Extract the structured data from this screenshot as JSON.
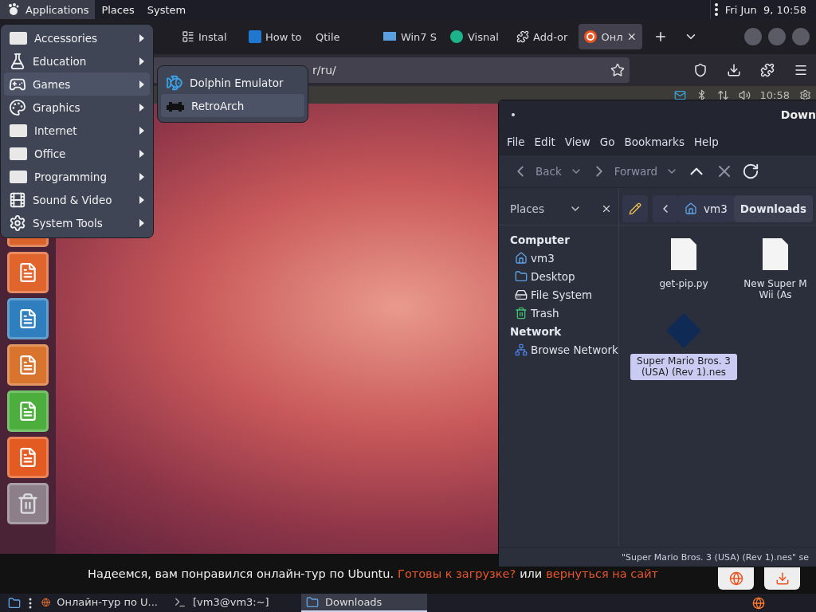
{
  "top_panel": {
    "menus": [
      {
        "label": "Applications",
        "selected": true
      },
      {
        "label": "Places",
        "selected": false
      },
      {
        "label": "System",
        "selected": false
      }
    ],
    "clock": "Fri Jun  9, 10:58"
  },
  "browser": {
    "tabs": [
      {
        "label": "Instal",
        "kind": "list",
        "selected": false
      },
      {
        "label": "How to",
        "kind": "letter",
        "selected": false
      },
      {
        "label": "Qtile",
        "kind": "none",
        "selected": false
      },
      {
        "label": "Win7 S",
        "kind": "windows",
        "selected": false
      },
      {
        "label": "Visnal",
        "kind": "badge",
        "selected": false
      },
      {
        "label": "Add-or",
        "kind": "puzzle",
        "selected": false
      },
      {
        "label": "Онл",
        "kind": "ubuntu",
        "selected": true
      }
    ],
    "url": "r/ru/",
    "tour": {
      "clock": "10:58",
      "caption": "Надеемся, вам понравился онлайн-тур по Ubuntu.",
      "link_download": "Готовы к загрузке?",
      "joiner": "или",
      "link_back": "вернуться на сайт"
    }
  },
  "app_menu": {
    "items": [
      {
        "label": "Accessories",
        "kind": "blank",
        "selected": false
      },
      {
        "label": "Education",
        "kind": "flask",
        "selected": false
      },
      {
        "label": "Games",
        "kind": "gamepad",
        "selected": true
      },
      {
        "label": "Graphics",
        "kind": "palette",
        "selected": false
      },
      {
        "label": "Internet",
        "kind": "blank",
        "selected": false
      },
      {
        "label": "Office",
        "kind": "blank",
        "selected": false
      },
      {
        "label": "Programming",
        "kind": "blank",
        "selected": false
      },
      {
        "label": "Sound & Video",
        "kind": "film",
        "selected": false
      },
      {
        "label": "System Tools",
        "kind": "gear",
        "selected": false
      }
    ]
  },
  "games_submenu": {
    "items": [
      {
        "label": "Dolphin Emulator",
        "kind": "dolphin",
        "selected": false
      },
      {
        "label": "RetroArch",
        "kind": "invader",
        "selected": true
      }
    ]
  },
  "file_manager": {
    "title": "Down",
    "menu": [
      "File",
      "Edit",
      "View",
      "Go",
      "Bookmarks",
      "Help"
    ],
    "toolbar": {
      "back": "Back",
      "forward": "Forward"
    },
    "sidebar": {
      "header": "Places",
      "sections": [
        {
          "heading": "Computer",
          "items": [
            {
              "label": "vm3",
              "kind": "home"
            },
            {
              "label": "Desktop",
              "kind": "folder"
            },
            {
              "label": "File System",
              "kind": "drive"
            },
            {
              "label": "Trash",
              "kind": "trash"
            }
          ]
        },
        {
          "heading": "Network",
          "items": [
            {
              "label": "Browse Network",
              "kind": "network"
            }
          ]
        }
      ]
    },
    "path": [
      {
        "label": "vm3",
        "kind": "home",
        "selected": false
      },
      {
        "label": "Downloads",
        "kind": "plain",
        "selected": true
      }
    ],
    "files": [
      {
        "name": "get-pip.py",
        "kind": "document",
        "selected": false
      },
      {
        "name": "New Super M\nWii (As",
        "kind": "document",
        "selected": false
      },
      {
        "name": "Super Mario Bros. 3 (USA) (Rev 1).nes",
        "kind": "rom",
        "selected": true
      }
    ],
    "status": "\"Super Mario Bros. 3 (USA) (Rev 1).nes\" se"
  },
  "taskbar": {
    "items": [
      {
        "label": "Онлайн-тур по U...",
        "kind": "browser",
        "selected": false
      },
      {
        "label": "[vm3@vm3:~]",
        "kind": "terminal",
        "selected": false
      },
      {
        "label": "Downloads",
        "kind": "folder",
        "selected": true
      }
    ]
  }
}
